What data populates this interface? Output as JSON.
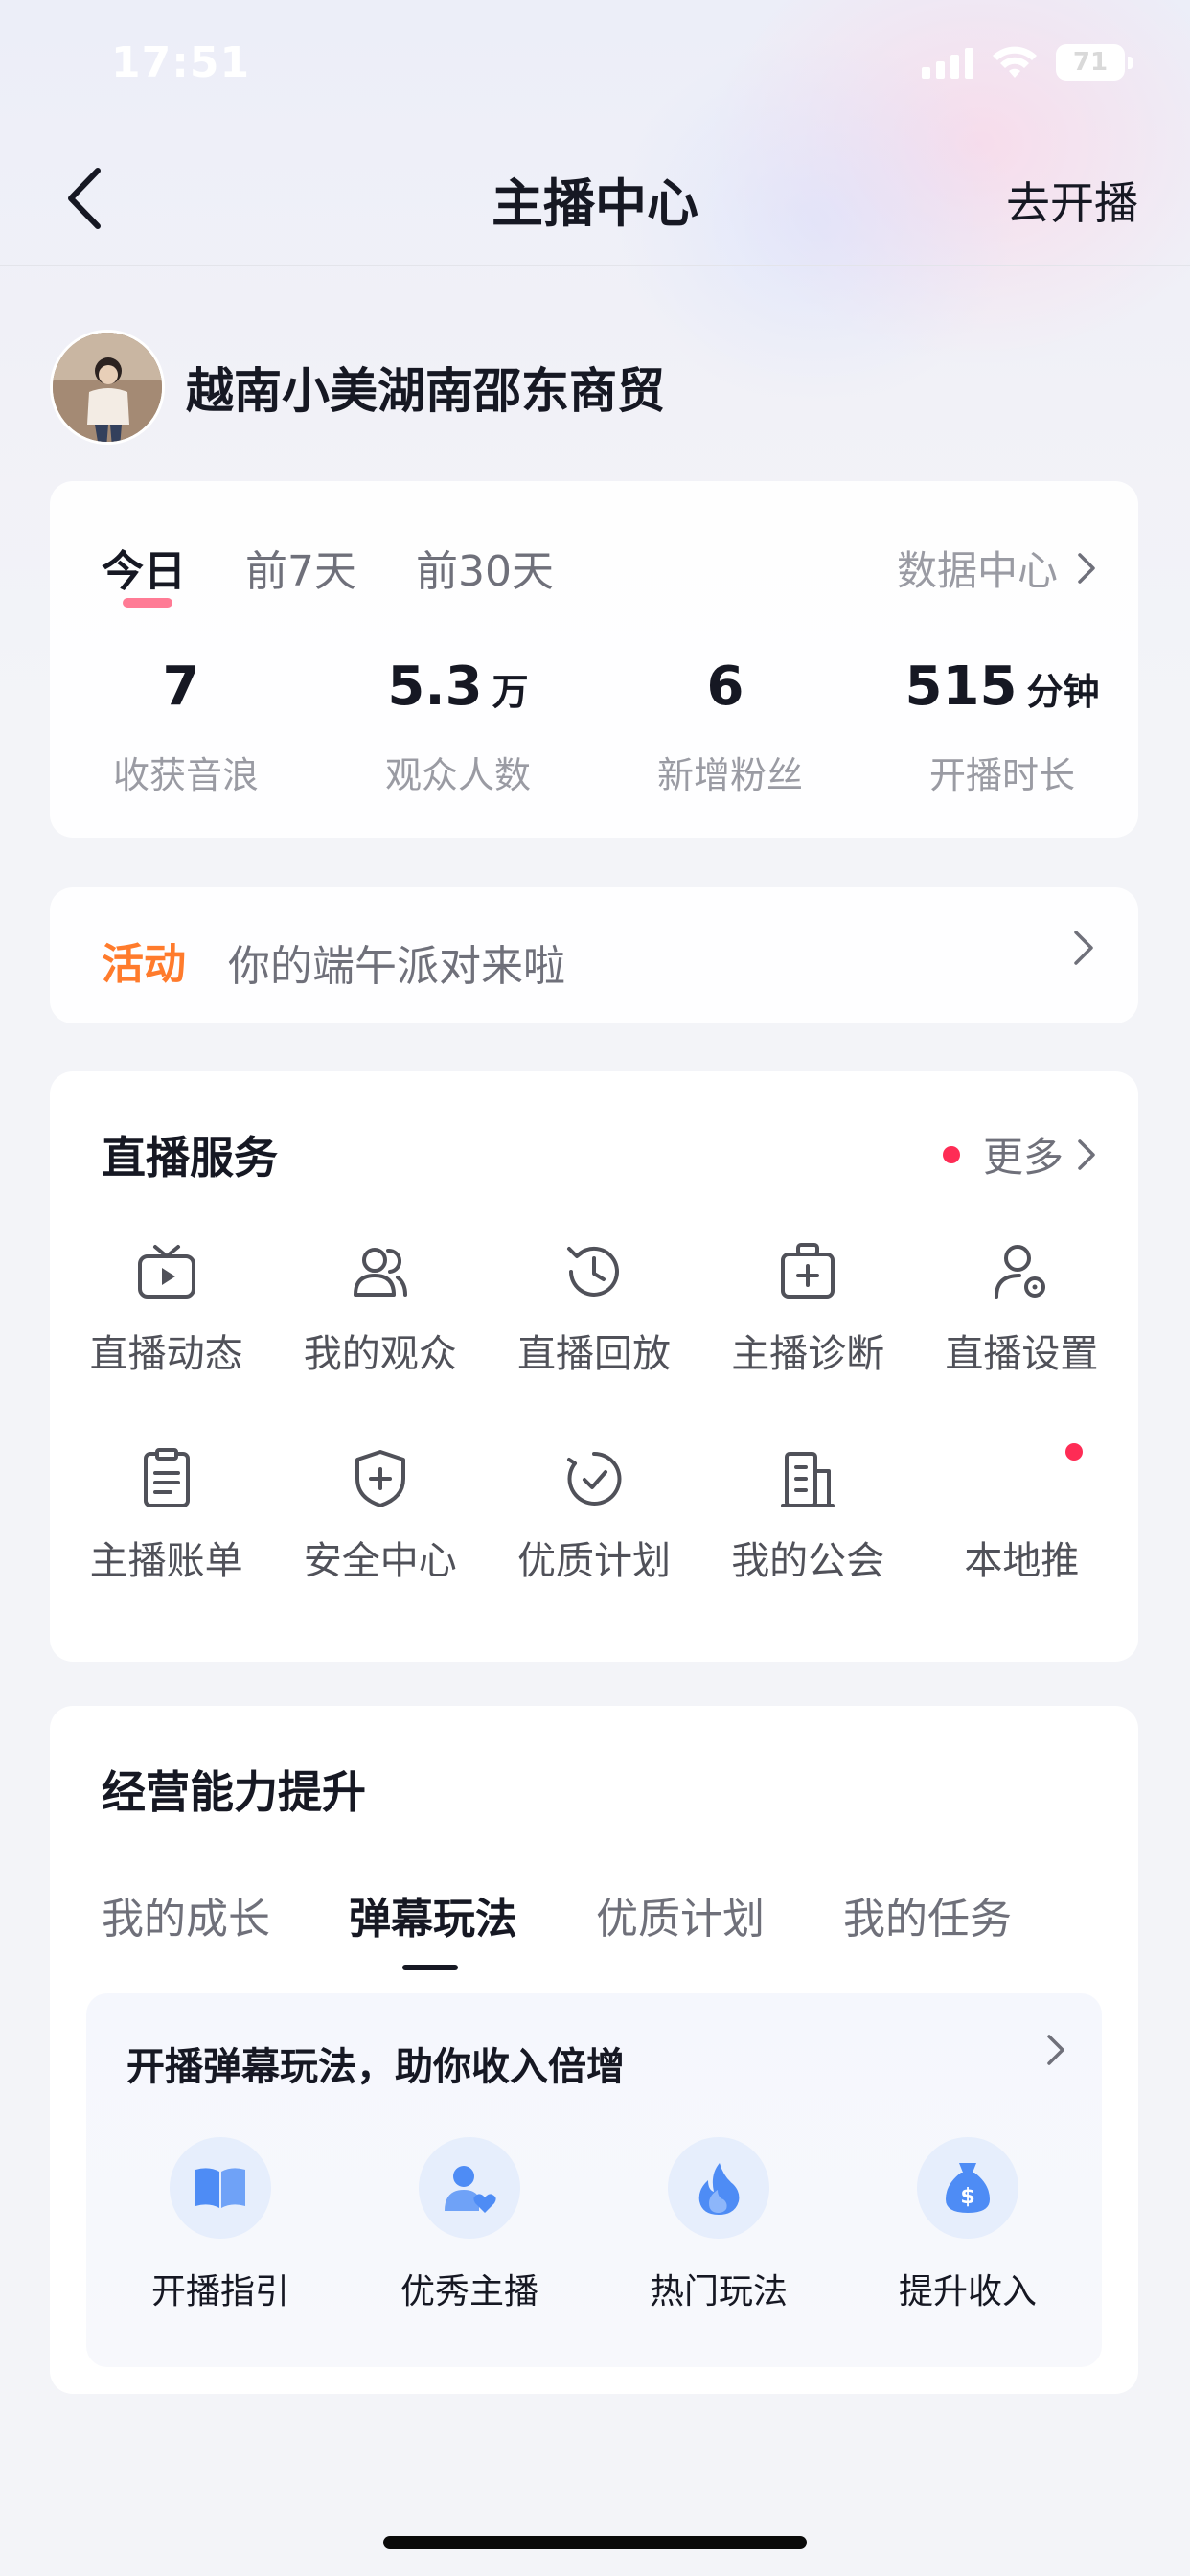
{
  "status_bar": {
    "time": "17:51",
    "battery": "71"
  },
  "nav": {
    "title": "主播中心",
    "action": "去开播"
  },
  "profile": {
    "name": "越南小美湖南邵东商贸"
  },
  "stats": {
    "tabs": [
      "今日",
      "前7天",
      "前30天"
    ],
    "active_tab": "今日",
    "data_center": "数据中心",
    "items": [
      {
        "value": "7",
        "unit": "",
        "label": "收获音浪"
      },
      {
        "value": "5.3",
        "unit": "万",
        "label": "观众人数"
      },
      {
        "value": "6",
        "unit": "",
        "label": "新增粉丝"
      },
      {
        "value": "515",
        "unit": "分钟",
        "label": "开播时长"
      }
    ]
  },
  "activity": {
    "tag": "活动",
    "text": "你的端午派对来啦"
  },
  "live_services": {
    "title": "直播服务",
    "more": "更多",
    "items": [
      {
        "label": "直播动态",
        "icon": "tv-icon"
      },
      {
        "label": "我的观众",
        "icon": "users-icon"
      },
      {
        "label": "直播回放",
        "icon": "history-icon"
      },
      {
        "label": "主播诊断",
        "icon": "medical-kit-icon"
      },
      {
        "label": "直播设置",
        "icon": "user-settings-icon"
      },
      {
        "label": "主播账单",
        "icon": "clipboard-icon"
      },
      {
        "label": "安全中心",
        "icon": "shield-plus-icon"
      },
      {
        "label": "优质计划",
        "icon": "check-circle-icon"
      },
      {
        "label": "我的公会",
        "icon": "building-icon"
      },
      {
        "label": "本地推",
        "icon": "",
        "badge": true
      }
    ]
  },
  "business": {
    "title": "经营能力提升",
    "tabs": [
      "我的成长",
      "弹幕玩法",
      "优质计划",
      "我的任务"
    ],
    "active_tab": "弹幕玩法",
    "card_title": "开播弹幕玩法，助你收入倍增",
    "features": [
      {
        "label": "开播指引",
        "icon": "book-icon"
      },
      {
        "label": "优秀主播",
        "icon": "user-heart-icon"
      },
      {
        "label": "热门玩法",
        "icon": "flame-icon"
      },
      {
        "label": "提升收入",
        "icon": "money-bag-icon"
      }
    ]
  },
  "colors": {
    "accent_red": "#fe2c55",
    "activity_orange": "#ff7b2c",
    "icon_blue": "#4e8cf5"
  }
}
